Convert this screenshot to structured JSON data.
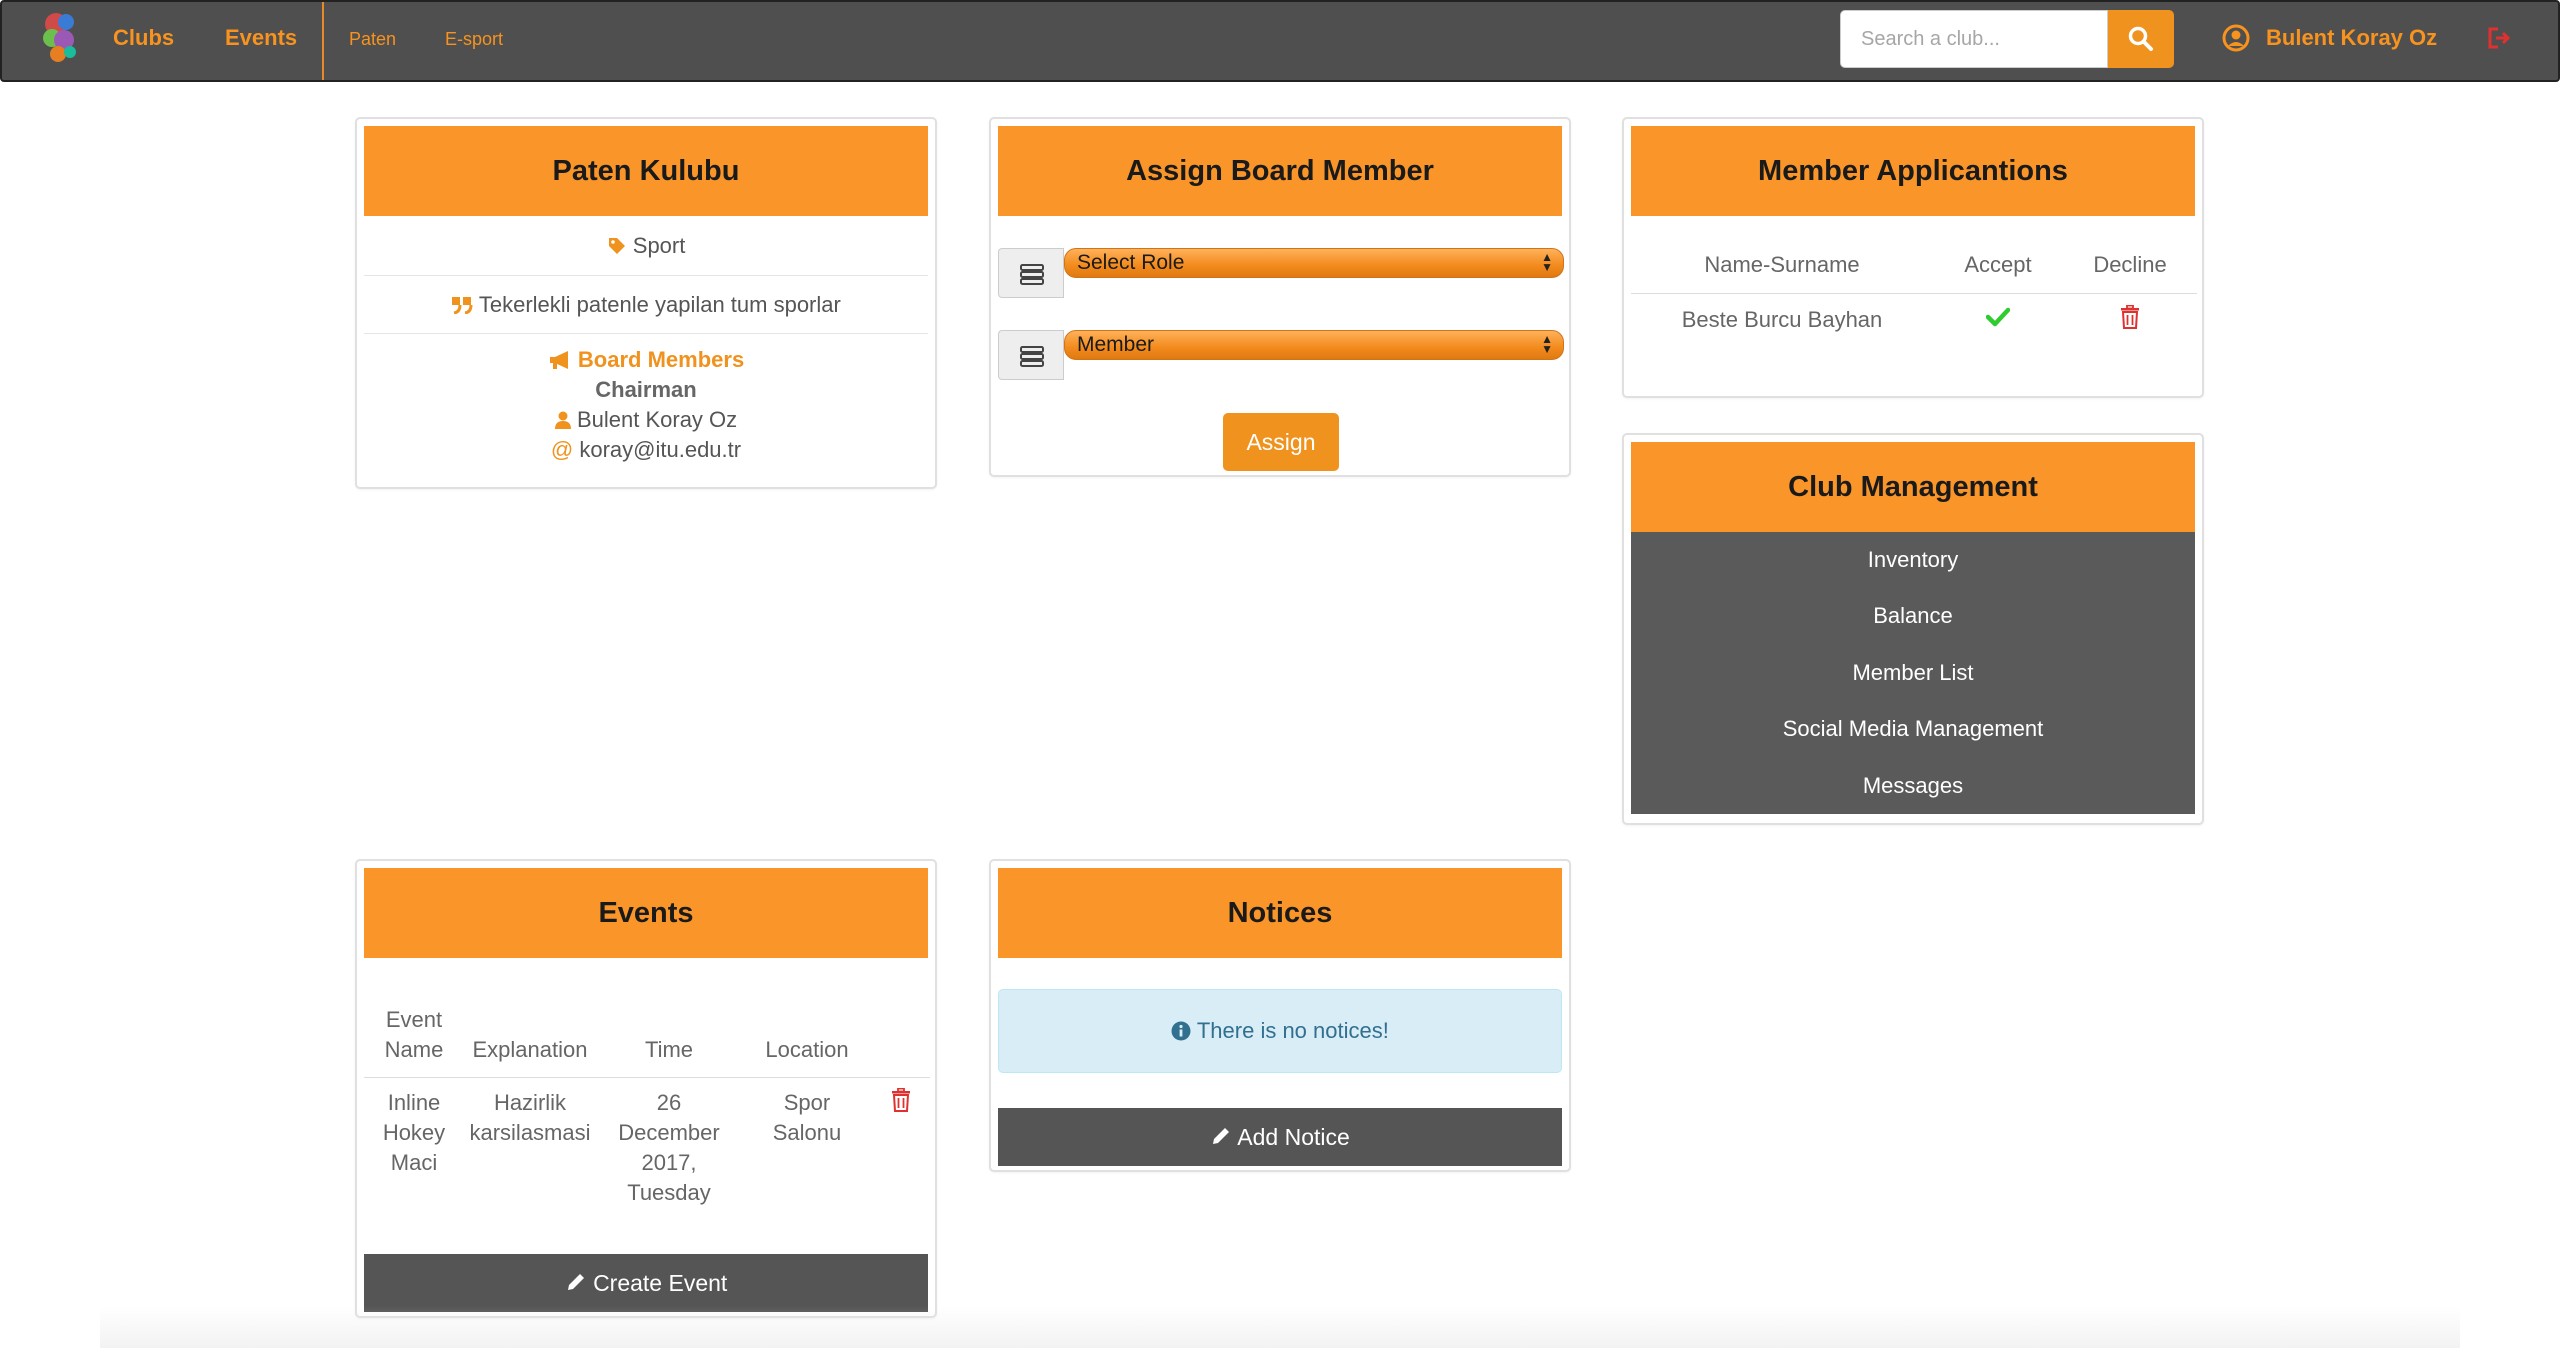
{
  "nav": {
    "clubs": "Clubs",
    "events": "Events",
    "sub_links": [
      "Paten",
      "E-sport"
    ],
    "search_placeholder": "Search a club...",
    "user_name": "Bulent Koray Oz"
  },
  "club_panel": {
    "title": "Paten Kulubu",
    "category": "Sport",
    "description": "Tekerlekli patenle yapilan tum sporlar",
    "board_title": "Board Members",
    "role": "Chairman",
    "member_name": "Bulent Koray Oz",
    "member_email": "koray@itu.edu.tr"
  },
  "assign_panel": {
    "title": "Assign Board Member",
    "role_select": "Select Role",
    "member_select": "Member",
    "assign_label": "Assign"
  },
  "applications_panel": {
    "title": "Member Applicantions",
    "columns": [
      "Name-Surname",
      "Accept",
      "Decline"
    ],
    "rows": [
      {
        "name": "Beste Burcu Bayhan"
      }
    ]
  },
  "management_panel": {
    "title": "Club Management",
    "items": [
      "Inventory",
      "Balance",
      "Member List",
      "Social Media Management",
      "Messages"
    ]
  },
  "events_panel": {
    "title": "Events",
    "columns": [
      "Event Name",
      "Explanation",
      "Time",
      "Location"
    ],
    "rows": [
      {
        "name": "Inline Hokey Maci",
        "explanation": "Hazirlik karsilasmasi",
        "time": "26 December 2017, Tuesday",
        "location": "Spor Salonu"
      }
    ],
    "create_label": "Create Event"
  },
  "notices_panel": {
    "title": "Notices",
    "empty_message": "There is no notices!",
    "add_label": "Add Notice"
  },
  "colors": {
    "accent": "#fa9629",
    "navbar": "#4f4f4f",
    "dark_button": "#555555",
    "success": "#2ecc2e",
    "danger": "#e03131",
    "info_bg": "#d9edf7"
  }
}
